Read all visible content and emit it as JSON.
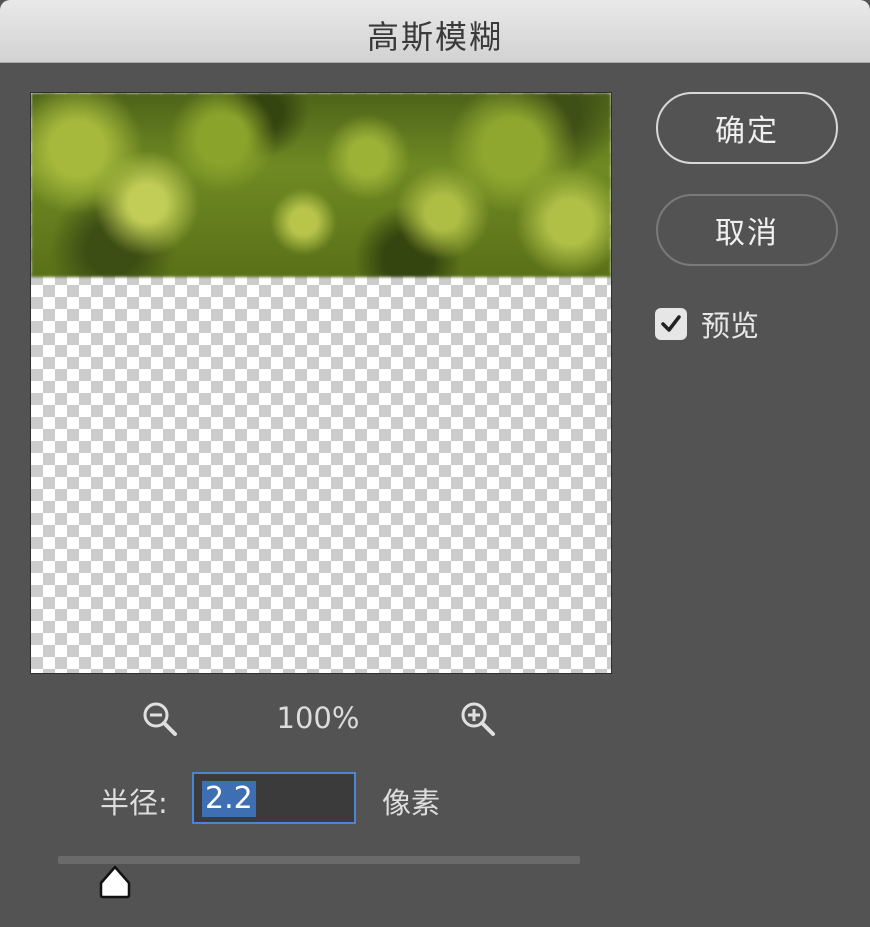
{
  "dialog": {
    "title": "高斯模糊"
  },
  "buttons": {
    "ok_label": "确定",
    "cancel_label": "取消"
  },
  "preview_option": {
    "label": "预览",
    "checked": true
  },
  "zoom": {
    "level": "100%",
    "zoom_out_icon": "zoom-out-icon",
    "zoom_in_icon": "zoom-in-icon"
  },
  "radius": {
    "label": "半径:",
    "value": "2.2",
    "unit": "像素"
  },
  "slider": {
    "value": 2.2
  },
  "colors": {
    "background": "#535353",
    "input_focus": "#4a86d4",
    "selection": "#3e6fb3"
  }
}
